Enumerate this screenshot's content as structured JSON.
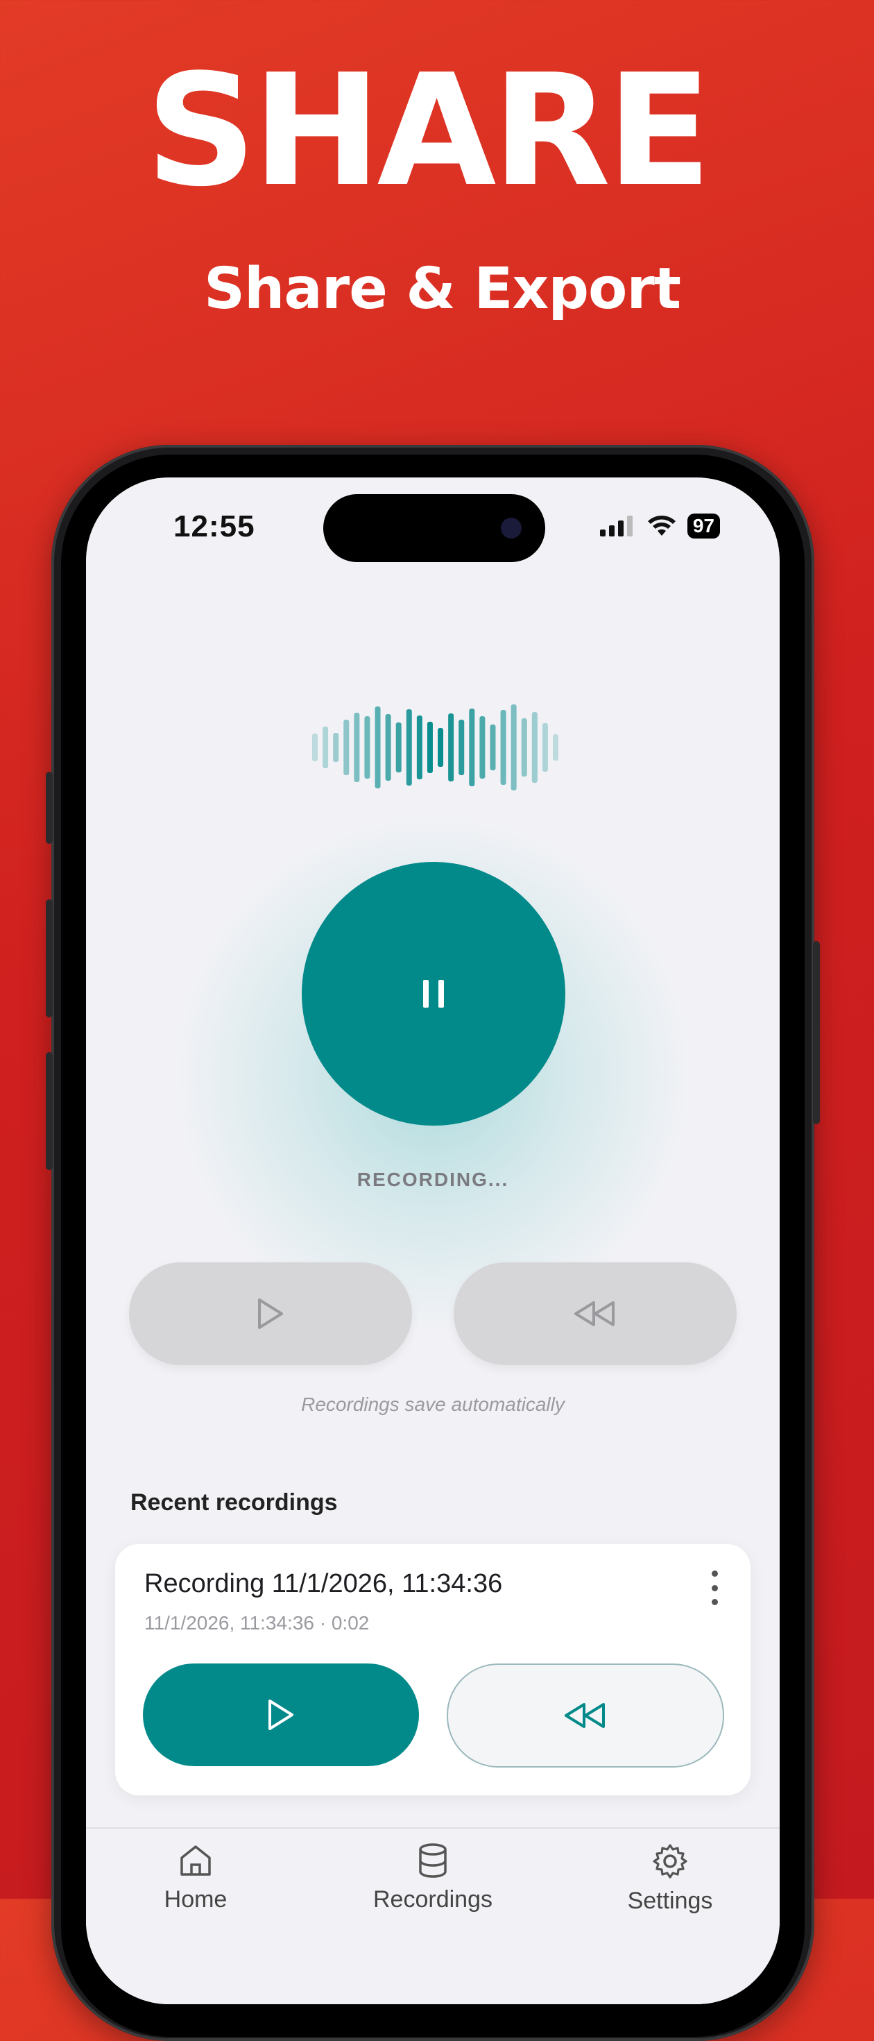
{
  "hero": {
    "title": "SHARE",
    "subtitle": "Share & Export"
  },
  "status_bar": {
    "time": "12:55",
    "battery": "97"
  },
  "recorder": {
    "status": "RECORDING...",
    "record_button_icon": "pause-icon",
    "play_icon": "play-icon",
    "rewind_icon": "rewind-icon",
    "hint": "Recordings save automatically"
  },
  "recent": {
    "title": "Recent recordings",
    "items": [
      {
        "title": "Recording 11/1/2026, 11:34:36",
        "meta": "11/1/2026, 11:34:36 · 0:02"
      }
    ]
  },
  "tabs": [
    {
      "label": "Home",
      "icon": "home-icon"
    },
    {
      "label": "Recordings",
      "icon": "database-icon"
    },
    {
      "label": "Settings",
      "icon": "gear-icon"
    }
  ],
  "colors": {
    "brand_red": "#d42620",
    "accent_teal": "#02898a",
    "disabled_gray": "#d6d6d8"
  }
}
